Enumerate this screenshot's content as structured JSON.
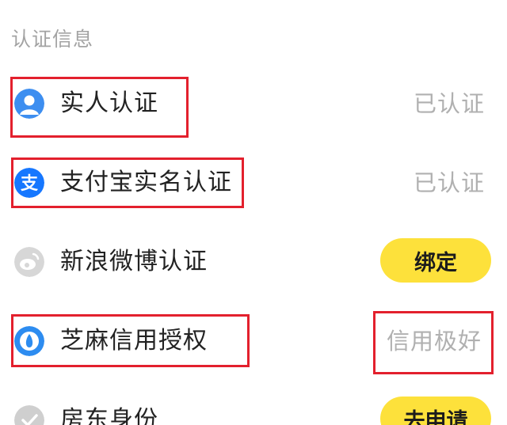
{
  "section": {
    "title": "认证信息"
  },
  "colors": {
    "button_bg": "#fde13b",
    "highlight_border": "#e3202d",
    "status_text": "#b0b0b0"
  },
  "rows": [
    {
      "icon": "person-icon",
      "label": "实人认证",
      "status": "已认证"
    },
    {
      "icon": "alipay-icon",
      "label": "支付宝实名认证",
      "status": "已认证"
    },
    {
      "icon": "weibo-icon",
      "label": "新浪微博认证",
      "button": "绑定"
    },
    {
      "icon": "sesame-icon",
      "label": "芝麻信用授权",
      "status": "信用极好"
    },
    {
      "icon": "check-icon",
      "label": "房东身份",
      "button": "去申请"
    }
  ]
}
